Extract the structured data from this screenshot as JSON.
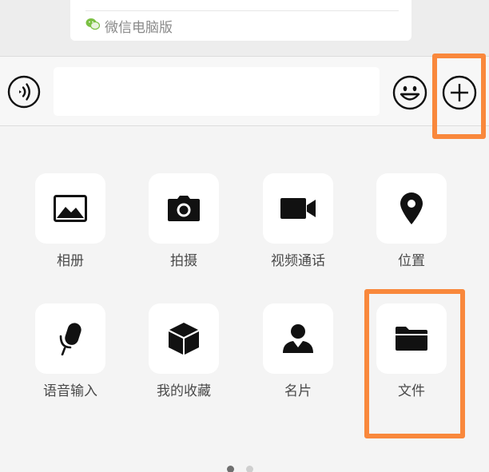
{
  "message": {
    "source_label": "微信电脑版",
    "source_icon": "wechat-logo-icon"
  },
  "input_bar": {
    "voice_icon": "voice-icon",
    "text_value": "",
    "emoji_icon": "emoji-icon",
    "more_icon": "plus-circle-icon"
  },
  "panel": {
    "items": [
      {
        "label": "相册",
        "icon": "photo-album-icon"
      },
      {
        "label": "拍摄",
        "icon": "camera-icon"
      },
      {
        "label": "视频通话",
        "icon": "video-call-icon"
      },
      {
        "label": "位置",
        "icon": "location-pin-icon"
      },
      {
        "label": "语音输入",
        "icon": "microphone-icon"
      },
      {
        "label": "我的收藏",
        "icon": "favorites-cube-icon"
      },
      {
        "label": "名片",
        "icon": "contact-card-icon"
      },
      {
        "label": "文件",
        "icon": "folder-icon"
      }
    ]
  },
  "pagination": {
    "current_page": 1,
    "total_pages": 2
  },
  "colors": {
    "highlight": "#f9883c",
    "tile_background": "#ffffff",
    "panel_background": "#f4f4f4"
  }
}
